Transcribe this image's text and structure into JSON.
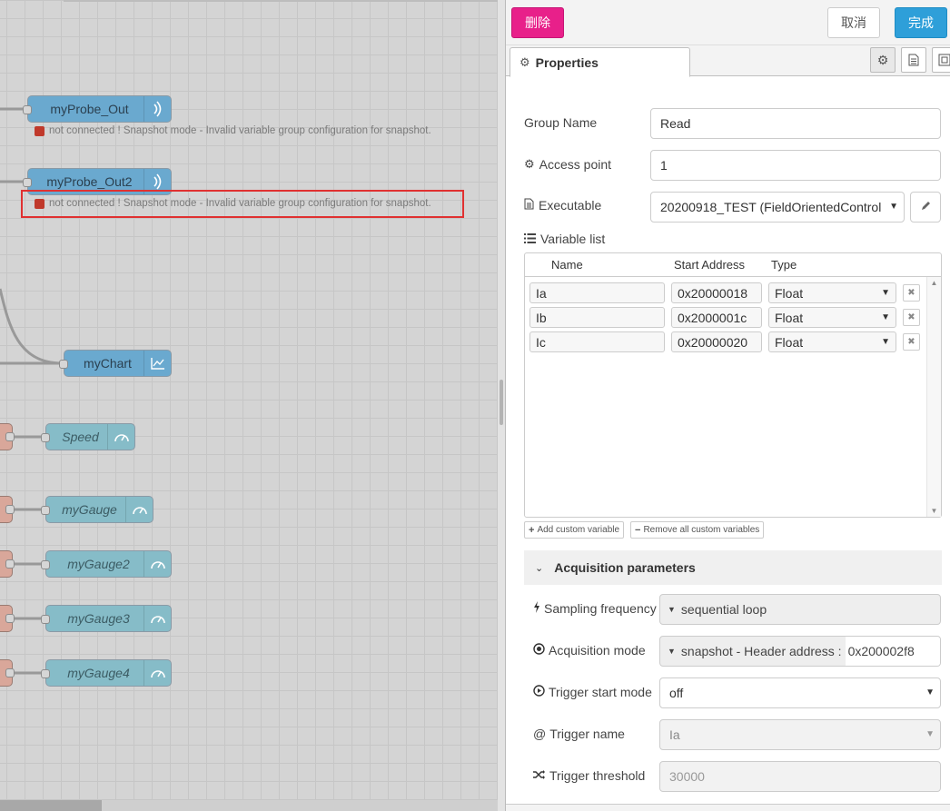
{
  "canvas": {
    "nodes": {
      "probe_out": "myProbe_Out",
      "probe_out2": "myProbe_Out2",
      "chart": "myChart",
      "speed": "Speed",
      "gauge": "myGauge",
      "gauge2": "myGauge2",
      "gauge3": "myGauge3",
      "gauge4": "myGauge4"
    },
    "status_text": "not connected ! Snapshot mode - Invalid variable group configuration for snapshot.",
    "status_color": "#c0392b"
  },
  "toolbar": {
    "delete_label": "删除",
    "cancel_label": "取消",
    "done_label": "完成"
  },
  "tabs": {
    "properties_label": "Properties"
  },
  "form": {
    "group_name_label": "Group Name",
    "group_name_value": "Read",
    "access_point_label": "Access point",
    "access_point_value": "1",
    "executable_label": "Executable",
    "executable_value": "20200918_TEST (FieldOrientedControl",
    "variable_list_label": "Variable list"
  },
  "variables": {
    "headers": {
      "name": "Name",
      "start_address": "Start Address",
      "type": "Type"
    },
    "rows": [
      {
        "name": "Ia",
        "address": "0x20000018",
        "type": "Float"
      },
      {
        "name": "Ib",
        "address": "0x2000001c",
        "type": "Float"
      },
      {
        "name": "Ic",
        "address": "0x20000020",
        "type": "Float"
      }
    ],
    "add_button": "Add custom variable",
    "remove_button": "Remove all custom variables"
  },
  "acquisition": {
    "title": "Acquisition parameters",
    "sampling_label": "Sampling frequency",
    "sampling_value": "sequential loop",
    "mode_label": "Acquisition mode",
    "mode_value": "snapshot - Header address :",
    "mode_address": "0x200002f8",
    "trigger_start_label": "Trigger start mode",
    "trigger_start_value": "off",
    "trigger_name_label": "Trigger name",
    "trigger_name_value": "Ia",
    "trigger_threshold_label": "Trigger threshold",
    "trigger_threshold_placeholder": "30000"
  },
  "colors": {
    "delete": "#e8208a",
    "done": "#2e9fd9",
    "probe_node": "#6aa9cf",
    "gauge_node": "#86bcc8",
    "highlight": "#e03131"
  }
}
